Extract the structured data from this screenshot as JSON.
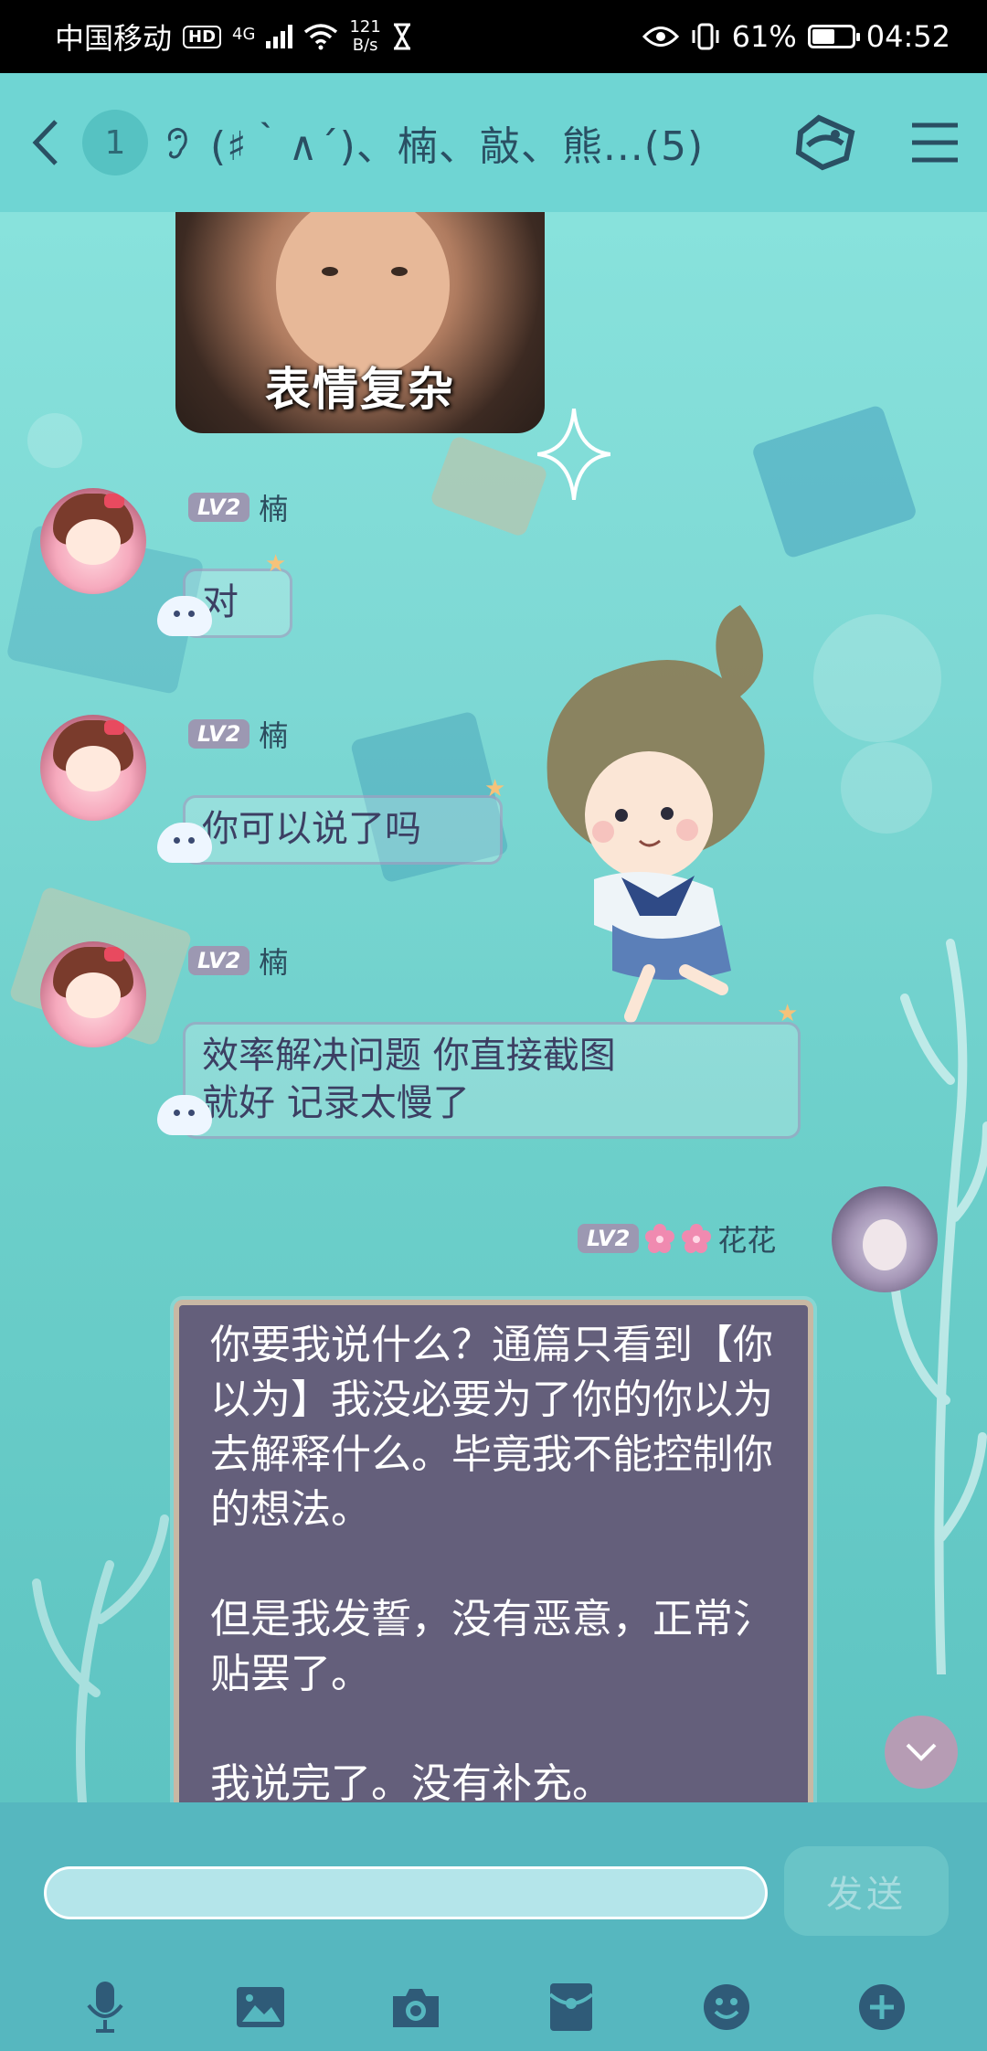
{
  "status_bar": {
    "carrier": "中国移动",
    "hd": "HD",
    "network": "4G",
    "speed_value": "121",
    "speed_unit": "B/s",
    "battery_percent": "61%",
    "battery_level": 0.61,
    "time": "04:52"
  },
  "header": {
    "unread_count": "1",
    "title": "(♯｀∧´)、楠、敲、熊...(5)"
  },
  "chat": {
    "sticker_caption": "表情复杂",
    "messages": [
      {
        "level": "LV2",
        "sender": "楠",
        "text": "对"
      },
      {
        "level": "LV2",
        "sender": "楠",
        "text": "你可以说了吗"
      },
      {
        "level": "LV2",
        "sender": "楠",
        "text_line1": "效率解决问题 你直接截图",
        "text_line2": "就好 记录太慢了"
      }
    ],
    "my_message": {
      "level": "LV2",
      "sender": "花花",
      "para1": "你要我说什么？通篇只看到【你以为】我没必要为了你的你以为去解释什么。毕竟我不能控制你的想法。",
      "para2": "但是我发誓，没有恶意，正常氵贴罢了。",
      "para3": "我说完了。没有补充。"
    }
  },
  "input": {
    "placeholder": "",
    "send_label": "发送"
  },
  "toolbar": {
    "icons": [
      "microphone-icon",
      "image-icon",
      "camera-icon",
      "red-packet-icon",
      "emoji-icon",
      "plus-icon"
    ]
  },
  "colors": {
    "header_bg": "#6fd5d3",
    "my_bubble_bg": "#645f7b",
    "input_area_bg": "#56b7bf"
  }
}
